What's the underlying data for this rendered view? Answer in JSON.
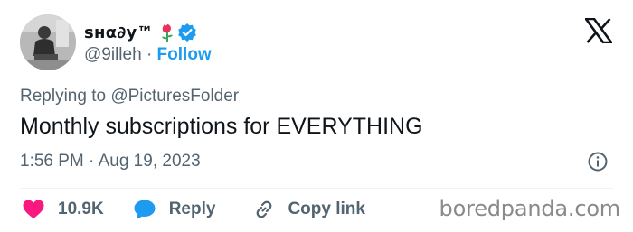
{
  "author": {
    "display_name": "ѕнα∂у™",
    "handle": "@9illeh",
    "separator": "·",
    "follow_label": "Follow",
    "verified": true
  },
  "tweet": {
    "replying_prefix": "Replying to",
    "replying_to": "@PicturesFolder",
    "text": "Monthly subscriptions for EVERYTHING",
    "timestamp": "1:56 PM · Aug 19, 2023"
  },
  "actions": {
    "like_count": "10.9K",
    "reply_label": "Reply",
    "copy_link_label": "Copy link"
  },
  "watermark": "boredpanda.com",
  "icons": {
    "platform_logo": "x-logo-icon",
    "badge": "verified-badge-icon",
    "emoji": "rose-emoji-icon",
    "info": "info-icon",
    "like": "heart-icon",
    "reply": "reply-bubble-icon",
    "copy": "link-icon"
  },
  "colors": {
    "text": "#0f1419",
    "secondary": "#536471",
    "accent": "#1d9bf0",
    "like": "#f91880",
    "divider": "#eff3f4"
  }
}
